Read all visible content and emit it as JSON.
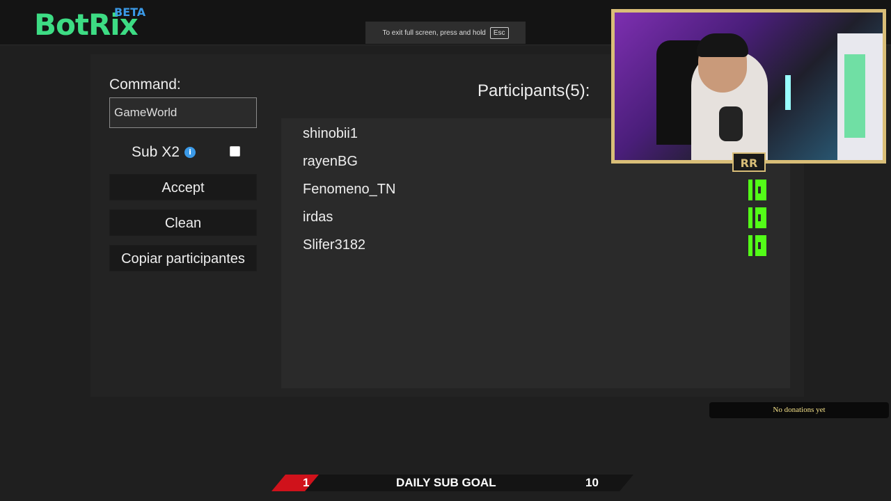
{
  "app": {
    "logo": "BotRix",
    "badge": "BETA"
  },
  "fullscreen_toast": {
    "text": "To exit full screen, press and hold",
    "key": "Esc"
  },
  "command": {
    "label": "Command:",
    "value": "GameWorld"
  },
  "sub_x2": {
    "label": "Sub X2",
    "info_icon": "info-icon",
    "checked": false
  },
  "buttons": {
    "accept": "Accept",
    "clean": "Clean",
    "copy": "Copiar participantes"
  },
  "participants": {
    "title": "Participants(5):",
    "items": [
      {
        "name": "shinobii1",
        "icon": "kick-icon"
      },
      {
        "name": "rayenBG",
        "icon": "kick-icon"
      },
      {
        "name": "Fenomeno_TN",
        "icon": "kick-icon"
      },
      {
        "name": "irdas",
        "icon": "kick-icon"
      },
      {
        "name": "Slifer3182",
        "icon": "kick-icon"
      }
    ]
  },
  "webcam": {
    "badge": "RR"
  },
  "donations": {
    "text": "No donations yet"
  },
  "sub_goal": {
    "current": "1",
    "label": "DAILY SUB GOAL",
    "target": "10",
    "progress": 0.1
  },
  "colors": {
    "accent_green": "#3ddc84",
    "beta_blue": "#3b9ae8",
    "kick_green": "#53fc18",
    "goal_red": "#d0121b",
    "cam_border": "#d9be78"
  }
}
